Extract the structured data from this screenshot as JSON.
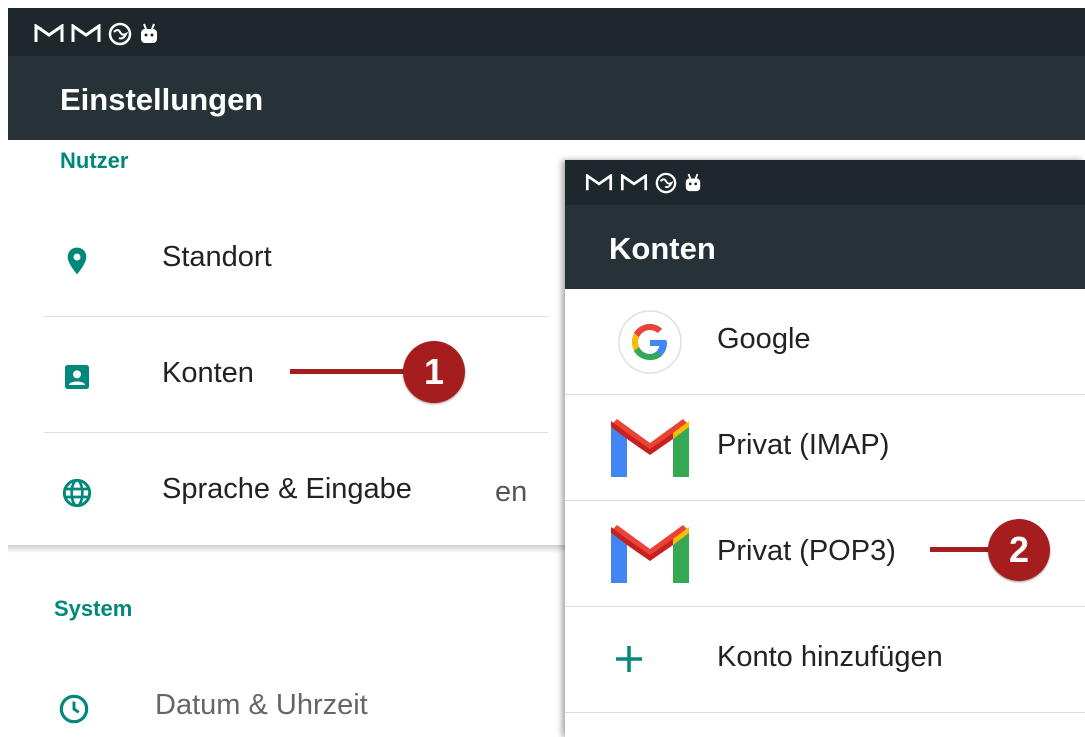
{
  "settings_screen": {
    "title": "Einstellungen",
    "categories": [
      {
        "header": "Nutzer",
        "items": [
          {
            "label": "Standort",
            "icon": "location-pin-icon"
          },
          {
            "label": "Konten",
            "icon": "account-box-icon"
          },
          {
            "label": "Sprache & Eingabe",
            "icon": "globe-icon"
          }
        ],
        "overflow_text": "en"
      },
      {
        "header": "System",
        "items": [
          {
            "label": "Datum & Uhrzeit",
            "icon": "clock-icon"
          }
        ]
      }
    ]
  },
  "accounts_screen": {
    "title": "Konten",
    "items": [
      {
        "label": "Google",
        "icon": "google-logo-icon"
      },
      {
        "label": "Privat (IMAP)",
        "icon": "gmail-icon"
      },
      {
        "label": "Privat (POP3)",
        "icon": "gmail-icon"
      },
      {
        "label": "Konto hinzufügen",
        "icon": "plus-icon"
      }
    ]
  },
  "status_icons": [
    "gmail-notification-icon",
    "gmail-notification-icon",
    "vpn-globe-icon",
    "android-icon"
  ],
  "callouts": [
    {
      "number": "1",
      "target": "Konten"
    },
    {
      "number": "2",
      "target": "Privat (POP3)"
    }
  ],
  "colors": {
    "statusbar": "#1e272c",
    "toolbar": "#263238",
    "accent": "#00897b",
    "callout": "#a51d1d"
  }
}
